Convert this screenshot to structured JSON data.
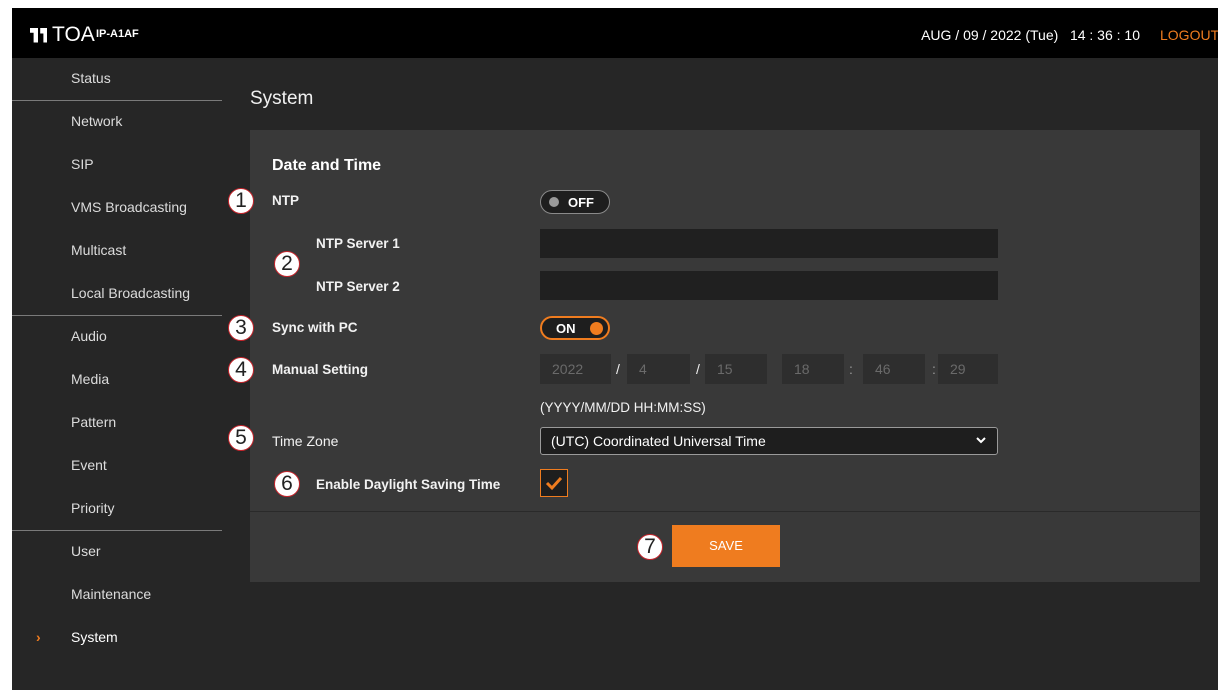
{
  "header": {
    "brand": "TOA",
    "model": "IP-A1AF",
    "datetime": "AUG / 09 / 2022 (Tue)   14 : 36 : 10",
    "logout": "LOGOUT"
  },
  "sidebar": {
    "items": [
      {
        "label": "Status"
      },
      {
        "label": "Network"
      },
      {
        "label": "SIP"
      },
      {
        "label": "VMS Broadcasting"
      },
      {
        "label": "Multicast"
      },
      {
        "label": "Local Broadcasting"
      },
      {
        "label": "Audio"
      },
      {
        "label": "Media"
      },
      {
        "label": "Pattern"
      },
      {
        "label": "Event"
      },
      {
        "label": "Priority"
      },
      {
        "label": "User"
      },
      {
        "label": "Maintenance"
      },
      {
        "label": "System",
        "active": true
      }
    ]
  },
  "page": {
    "title": "System",
    "section_title": "Date and Time",
    "ntp": {
      "label": "NTP",
      "state": "OFF"
    },
    "ntp_server_1": {
      "label": "NTP Server 1",
      "value": ""
    },
    "ntp_server_2": {
      "label": "NTP Server 2",
      "value": ""
    },
    "sync_pc": {
      "label": "Sync with PC",
      "state": "ON"
    },
    "manual": {
      "label": "Manual Setting",
      "year": "2022",
      "month": "4",
      "day": "15",
      "hour": "18",
      "minute": "46",
      "second": "29",
      "date_sep": "/",
      "time_sep": ":",
      "format_hint": "(YYYY/MM/DD HH:MM:SS)"
    },
    "time_zone": {
      "label": "Time Zone",
      "value": "(UTC) Coordinated Universal Time"
    },
    "dst": {
      "label": "Enable Daylight Saving Time",
      "checked": true
    },
    "save_label": "SAVE"
  },
  "callouts": [
    "1",
    "2",
    "3",
    "4",
    "5",
    "6",
    "7"
  ],
  "colors": {
    "accent": "#ef7c1f",
    "callout_border": "#c4242b",
    "background": "#262626",
    "panel": "#393939"
  }
}
